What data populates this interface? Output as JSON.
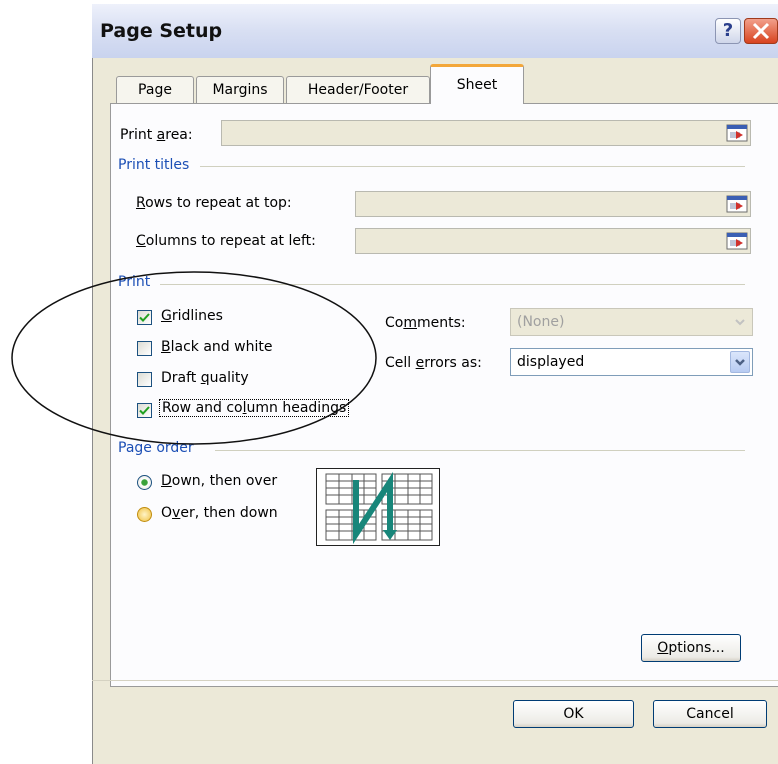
{
  "window": {
    "title": "Page Setup",
    "help_glyph": "?",
    "close_glyph": "×"
  },
  "tabs": [
    {
      "label": "Page",
      "selected": false
    },
    {
      "label": "Margins",
      "selected": false
    },
    {
      "label": "Header/Footer",
      "selected": false
    },
    {
      "label": "Sheet",
      "selected": true
    }
  ],
  "print_area": {
    "label": "Print area:",
    "value": ""
  },
  "print_titles": {
    "heading": "Print titles",
    "rows_label": "Rows to repeat at top:",
    "rows_value": "",
    "cols_label": "Columns to repeat at left:",
    "cols_value": ""
  },
  "print": {
    "heading": "Print",
    "options": [
      {
        "label": "Gridlines",
        "checked": true
      },
      {
        "label": "Black and white",
        "checked": false
      },
      {
        "label": "Draft quality",
        "checked": false
      },
      {
        "label": "Row and column headings",
        "checked": true
      }
    ],
    "comments_label": "Comments:",
    "comments_value": "(None)",
    "cell_errors_label": "Cell errors as:",
    "cell_errors_value": "displayed"
  },
  "page_order": {
    "heading": "Page order",
    "options": [
      {
        "label": "Down, then over",
        "selected": true
      },
      {
        "label": "Over, then down",
        "selected": false
      }
    ]
  },
  "buttons": {
    "options": "Options...",
    "ok": "OK",
    "cancel": "Cancel"
  },
  "colors": {
    "group_heading": "#1c4fb5",
    "tab_highlight": "#f3a73a",
    "dialog_face": "#ece9d8"
  },
  "icons": [
    "help-icon",
    "close-icon",
    "collapse-dialog-icon",
    "dropdown-arrow-icon",
    "check-icon",
    "page-order-preview-icon"
  ]
}
